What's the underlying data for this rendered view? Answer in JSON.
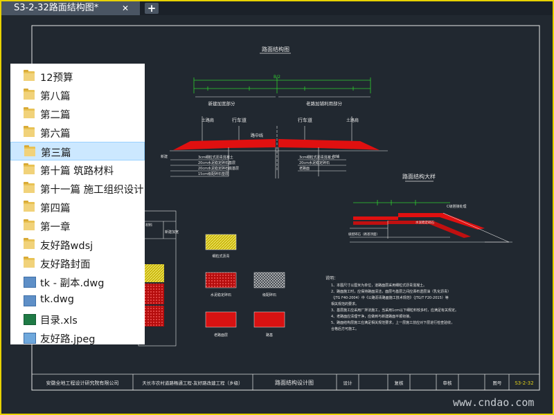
{
  "tab": {
    "title": "S3-2-32路面结构图*",
    "close_glyph": "✕",
    "add_glyph": "+"
  },
  "drawing": {
    "main_title": "路面结构图",
    "detail_title": "路面结构大样",
    "width_label": "B/2",
    "left_part_label": "新建加宽部分",
    "right_part_label": "老路加铺利用部分",
    "center_label": "路中线",
    "left_lane_label": "行车道",
    "right_lane_label": "行车道",
    "left_shoulder_label": "土路肩",
    "right_shoulder_label": "土路肩",
    "new_road_label": "新建",
    "overlay_label": "加铺",
    "left_layers": [
      "3cm细粒式沥青混凝土",
      "20cm水泥稳定碎石基层",
      "20cm水泥稳定碎石底基层",
      "15cm级配碎石垫层"
    ],
    "right_layers": [
      "3cm细粒式沥青混凝土",
      "20cm水泥稳定碎石",
      "老路面"
    ],
    "detail_labels": [
      "C级搭接处理",
      "水泥稳定碎石",
      "级配碎石（路基顶面）"
    ],
    "legend_header": [
      "材料",
      "",
      "新建加宽"
    ],
    "legend_items": [
      "细粒式沥青",
      "水泥稳定碎石",
      "级配碎石",
      "老路面层",
      "路基"
    ],
    "notes_title": "说明：",
    "notes": [
      "1、本图尺寸以厘米为单位，道路面层采用细粒式沥青混凝土。",
      "2、路面施工时，应保持路面清洁，面层与基层之间应洒布透层油（乳化沥青）",
      "  （JTG F40-2004）中《公路沥青路面施工技术规范》（JTG/T F20-2015）等",
      "  相关规范的要求。",
      "3、基层施工应采用厂拌法施工，当采用1cm以下细粒料较多时，应满足有关规定。",
      "4、老路面应清理干净，应做到与新建路面平顺衔接。",
      "5、路面结构层施工应满足相关规范要求，上一层施工前应对下层进行检查验收，",
      "  合格后方可施工。"
    ],
    "titleblock": {
      "company": "安徽全地工程设计研究院有限公司",
      "project": "天长市农村道路畅通工程-友好路改建工程（乡级）",
      "drawing_name": "路面结构设计图",
      "design": "设计",
      "check": "复核",
      "review": "审核",
      "drawing_no_label": "图号",
      "drawing_no": "S3-2-32"
    }
  },
  "watermark": "www.cndao.com",
  "popup": {
    "items": [
      {
        "icon": "folder-icon",
        "label": "12预算",
        "selected": false
      },
      {
        "icon": "folder-icon",
        "label": "第八篇",
        "selected": false
      },
      {
        "icon": "folder-icon",
        "label": "第二篇",
        "selected": false
      },
      {
        "icon": "folder-icon",
        "label": "第六篇",
        "selected": false
      },
      {
        "icon": "folder-icon",
        "label": "第三篇",
        "selected": true
      },
      {
        "icon": "folder-icon",
        "label": "第十篇 筑路材料",
        "selected": false
      },
      {
        "icon": "folder-icon",
        "label": "第十一篇 施工组织设计",
        "selected": false
      },
      {
        "icon": "folder-icon",
        "label": "第四篇",
        "selected": false
      },
      {
        "icon": "folder-icon",
        "label": "第一章",
        "selected": false
      },
      {
        "icon": "folder-icon",
        "label": "友好路wdsj",
        "selected": false
      },
      {
        "icon": "folder-icon",
        "label": "友好路封面",
        "selected": false
      },
      {
        "icon": "dwg-file-icon",
        "label": "tk - 副本.dwg",
        "selected": false
      },
      {
        "icon": "dwg-file-icon",
        "label": "tk.dwg",
        "selected": false
      },
      {
        "icon": "xls-file-icon",
        "label": "目录.xls",
        "selected": false
      },
      {
        "icon": "image-file-icon",
        "label": "友好路.jpeg",
        "selected": false
      }
    ]
  },
  "colors": {
    "frame": "#e8d200",
    "canvas": "#212830",
    "pavement_red": "#e01010",
    "cad_green": "#2fcf2f",
    "cad_white": "#e8e8e8",
    "yellow_hatch": "#e3d21a",
    "selection": "#cce8ff"
  }
}
